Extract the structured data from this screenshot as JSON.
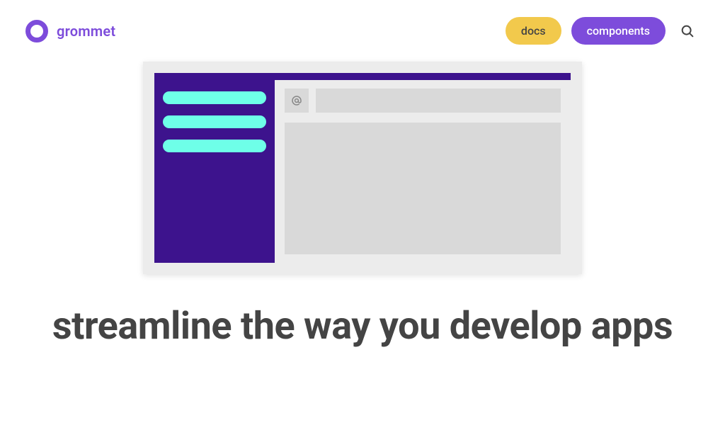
{
  "header": {
    "brand": "grommet",
    "nav": {
      "docs": "docs",
      "components": "components"
    }
  },
  "hero": {
    "headline": "streamline the way you develop apps"
  }
}
